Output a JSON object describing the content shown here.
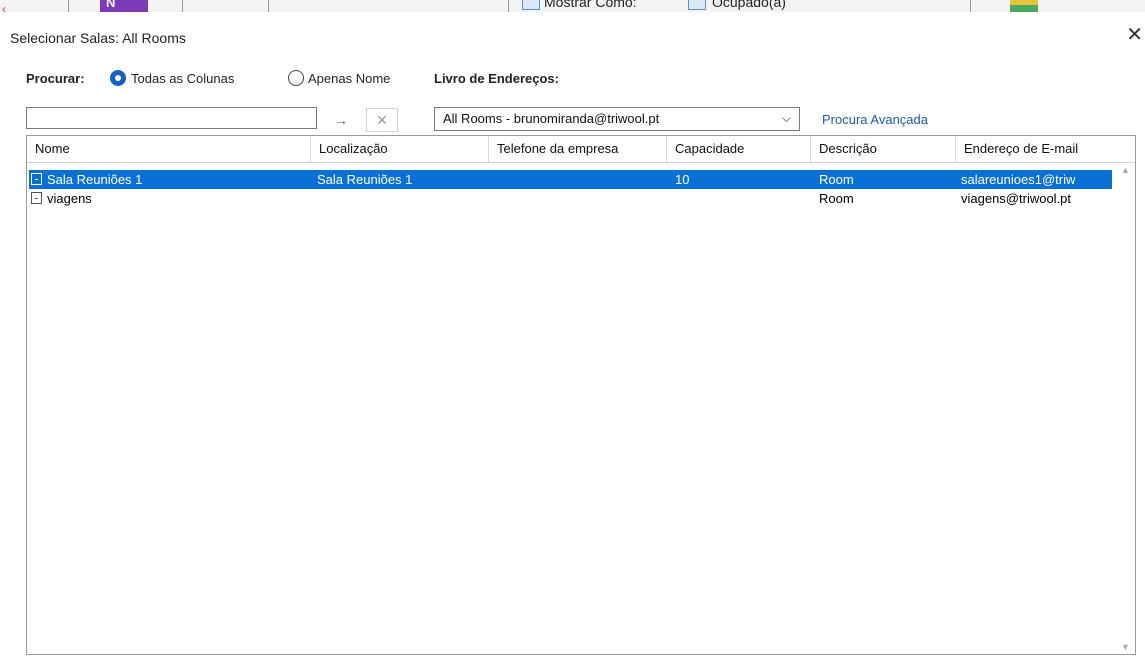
{
  "background_ribbon": {
    "labels": [
      "Mostrar Como:",
      "Ocupado(a)"
    ],
    "onenote_letter": "N"
  },
  "dialog": {
    "title": "Selecionar Salas: All Rooms",
    "close_glyph": "✕",
    "search": {
      "label": "Procurar:",
      "radio_all_columns": "Todas as Colunas",
      "radio_name_only": "Apenas Nome",
      "selected": "Todas as Colunas",
      "input_value": "",
      "go_glyph": "→",
      "clear_glyph": "✕"
    },
    "address_book": {
      "label": "Livro de Endereços:",
      "selected": "All Rooms - brunomiranda@triwool.pt",
      "chevron_glyph": "⌵"
    },
    "advanced_search_link": "Procura Avançada"
  },
  "table": {
    "columns": [
      "Nome",
      "Localização",
      "Telefone da empresa",
      "Capacidade",
      "Descrição",
      "Endereço de E-mail"
    ],
    "rows": [
      {
        "nome": "Sala Reuniões 1",
        "localizacao": "Sala Reuniões 1",
        "telefone": "",
        "capacidade": "10",
        "descricao": "Room",
        "email": "salareunioes1@triw",
        "selected": true
      },
      {
        "nome": "viagens",
        "localizacao": "",
        "telefone": "",
        "capacidade": "",
        "descricao": "Room",
        "email": "viagens@triwool.pt",
        "selected": false
      }
    ]
  },
  "colors": {
    "selection": "#0a70d6",
    "link": "#1a5bb5",
    "radio_selected": "#1560c2"
  }
}
